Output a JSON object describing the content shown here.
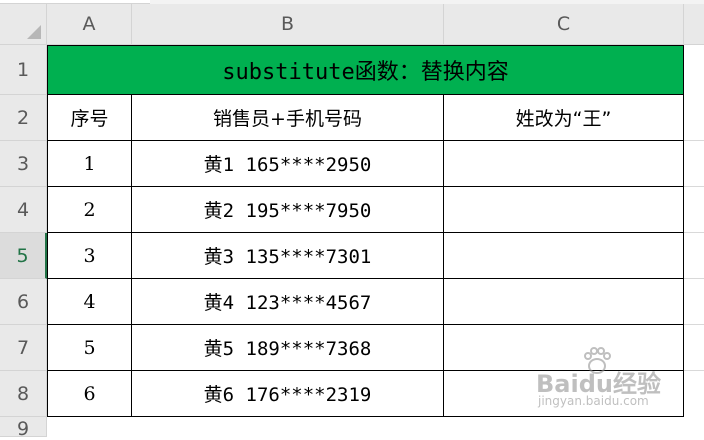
{
  "columns": [
    "A",
    "B",
    "C"
  ],
  "rows": [
    "1",
    "2",
    "3",
    "4",
    "5",
    "6",
    "7",
    "8",
    "9"
  ],
  "active_row": "5",
  "title": "substitute函数：替换内容",
  "headers": [
    "序号",
    "销售员+手机号码",
    "姓改为“王”"
  ],
  "data": [
    {
      "index": "1",
      "value": "黄1 165****2950",
      "result": ""
    },
    {
      "index": "2",
      "value": "黄2 195****7950",
      "result": ""
    },
    {
      "index": "3",
      "value": "黄3 135****7301",
      "result": ""
    },
    {
      "index": "4",
      "value": "黄4 123****4567",
      "result": ""
    },
    {
      "index": "5",
      "value": "黄5 189****7368",
      "result": ""
    },
    {
      "index": "6",
      "value": "黄6 176****2319",
      "result": ""
    }
  ],
  "watermark": {
    "text": "Baidu经验",
    "sub": "jingyan.baidu.com"
  },
  "colors": {
    "title_fill": "#00b050",
    "header_bg": "#e9e9e9",
    "active_row_color": "#217346"
  }
}
